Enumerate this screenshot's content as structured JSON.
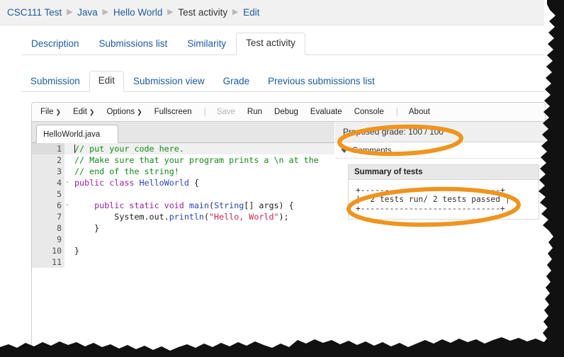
{
  "breadcrumb": {
    "items": [
      {
        "label": "CSC111 Test",
        "current": false
      },
      {
        "label": "Java",
        "current": false
      },
      {
        "label": "Hello World",
        "current": false
      },
      {
        "label": "Test activity",
        "current": true
      },
      {
        "label": "Edit",
        "current": false
      }
    ],
    "separator": "▶"
  },
  "tabs_primary": [
    {
      "label": "Description",
      "active": false
    },
    {
      "label": "Submissions list",
      "active": false
    },
    {
      "label": "Similarity",
      "active": false
    },
    {
      "label": "Test activity",
      "active": true
    }
  ],
  "tabs_secondary": [
    {
      "label": "Submission",
      "active": false
    },
    {
      "label": "Edit",
      "active": true
    },
    {
      "label": "Submission view",
      "active": false
    },
    {
      "label": "Grade",
      "active": false
    },
    {
      "label": "Previous submissions list",
      "active": false
    }
  ],
  "editor": {
    "menu": [
      {
        "label": "File",
        "caret": true,
        "disabled": false,
        "sep": false
      },
      {
        "label": "Edit",
        "caret": true,
        "disabled": false,
        "sep": false
      },
      {
        "label": "Options",
        "caret": true,
        "disabled": false,
        "sep": false
      },
      {
        "label": "Fullscreen",
        "caret": false,
        "disabled": false,
        "sep": false
      },
      {
        "label": "|",
        "caret": false,
        "disabled": false,
        "sep": true
      },
      {
        "label": "Save",
        "caret": false,
        "disabled": true,
        "sep": false
      },
      {
        "label": "Run",
        "caret": false,
        "disabled": false,
        "sep": false
      },
      {
        "label": "Debug",
        "caret": false,
        "disabled": false,
        "sep": false
      },
      {
        "label": "Evaluate",
        "caret": false,
        "disabled": false,
        "sep": false
      },
      {
        "label": "Console",
        "caret": false,
        "disabled": false,
        "sep": false
      },
      {
        "label": "|",
        "caret": false,
        "disabled": false,
        "sep": true
      },
      {
        "label": "About",
        "caret": false,
        "disabled": false,
        "sep": false
      }
    ],
    "file_tab": {
      "name": "HelloWorld.java",
      "dropdown_icon": "chevron-down-icon"
    },
    "code_lines": [
      {
        "n": "1",
        "fold": "",
        "active": true,
        "tokens": [
          {
            "t": "// put your code here.",
            "c": "cmt"
          }
        ]
      },
      {
        "n": "2",
        "fold": "",
        "active": false,
        "tokens": [
          {
            "t": "// Make sure that your program prints a \\n at the",
            "c": "cmt"
          }
        ]
      },
      {
        "n": "3",
        "fold": "",
        "active": false,
        "tokens": [
          {
            "t": "// end of the string!",
            "c": "cmt"
          }
        ]
      },
      {
        "n": "4",
        "fold": "-",
        "active": false,
        "tokens": [
          {
            "t": "public class ",
            "c": "kw"
          },
          {
            "t": "HelloWorld",
            "c": "typ"
          },
          {
            "t": " {",
            "c": "pln"
          }
        ]
      },
      {
        "n": "5",
        "fold": "",
        "active": false,
        "tokens": []
      },
      {
        "n": "6",
        "fold": "-",
        "active": false,
        "tokens": [
          {
            "t": "    ",
            "c": "pln"
          },
          {
            "t": "public static void ",
            "c": "kw"
          },
          {
            "t": "main",
            "c": "typ"
          },
          {
            "t": "(",
            "c": "pln"
          },
          {
            "t": "String",
            "c": "typ"
          },
          {
            "t": "[] args) {",
            "c": "pln"
          }
        ]
      },
      {
        "n": "7",
        "fold": "",
        "active": false,
        "tokens": [
          {
            "t": "        System.out.",
            "c": "pln"
          },
          {
            "t": "println",
            "c": "typ"
          },
          {
            "t": "(",
            "c": "pln"
          },
          {
            "t": "\"Hello, World\"",
            "c": "str"
          },
          {
            "t": ");",
            "c": "pln"
          }
        ]
      },
      {
        "n": "8",
        "fold": "",
        "active": false,
        "tokens": [
          {
            "t": "    }",
            "c": "pln"
          }
        ]
      },
      {
        "n": "9",
        "fold": "",
        "active": false,
        "tokens": []
      },
      {
        "n": "10",
        "fold": "",
        "active": false,
        "tokens": [
          {
            "t": "}",
            "c": "pln"
          }
        ]
      },
      {
        "n": "11",
        "fold": "",
        "active": false,
        "tokens": []
      }
    ]
  },
  "grading": {
    "proposed_grade_label": "Proposed grade: 100 / 100",
    "comments_label": "Comments",
    "summary_title": "Summary of tests",
    "summary_text": "+-----------------------------+\n|  2 tests run/ 2 tests passed |\n+-----------------------------+"
  },
  "annotations": {
    "color": "#F0941E",
    "ellipse_grade": "Proposed grade: 100 / 100",
    "ellipse_tests": "2 tests run/ 2 tests passed"
  }
}
